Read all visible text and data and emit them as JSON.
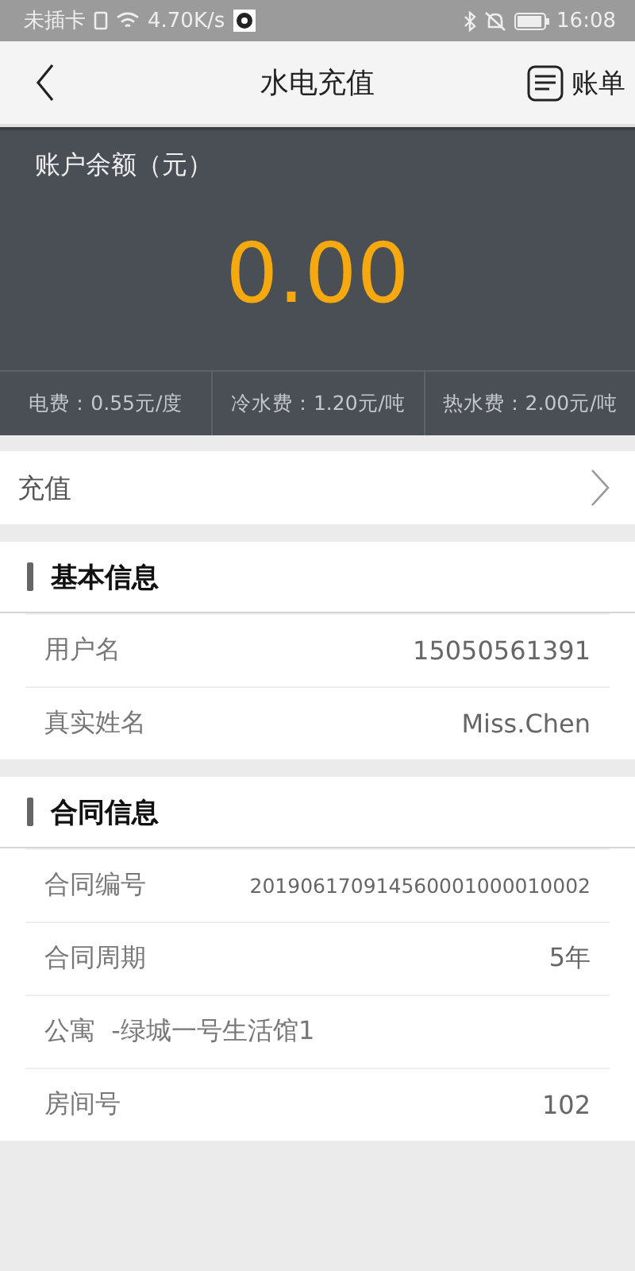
{
  "status_bar": {
    "carrier": "未插卡",
    "speed": "4.70K/s",
    "time": "16:08"
  },
  "header": {
    "title": "水电充值",
    "action": "账单"
  },
  "balance": {
    "label": "账户余额（元）",
    "amount": "0.00",
    "rates": [
      "电费：0.55元/度",
      "冷水费：1.20元/吨",
      "热水费：2.00元/吨"
    ]
  },
  "recharge": {
    "label": "充值"
  },
  "sections": [
    {
      "title": "基本信息",
      "rows": [
        {
          "label": "用户名",
          "value": "15050561391"
        },
        {
          "label": "真实姓名",
          "value": "Miss.Chen"
        }
      ]
    },
    {
      "title": "合同信息",
      "rows": [
        {
          "label": "合同编号",
          "value": "201906170914560001000010002",
          "kind": "small"
        },
        {
          "label": "合同周期",
          "value": "5年"
        },
        {
          "label": "公寓  -绿城一号生活馆1"
        },
        {
          "label": "房间号",
          "value": "102"
        }
      ]
    }
  ]
}
